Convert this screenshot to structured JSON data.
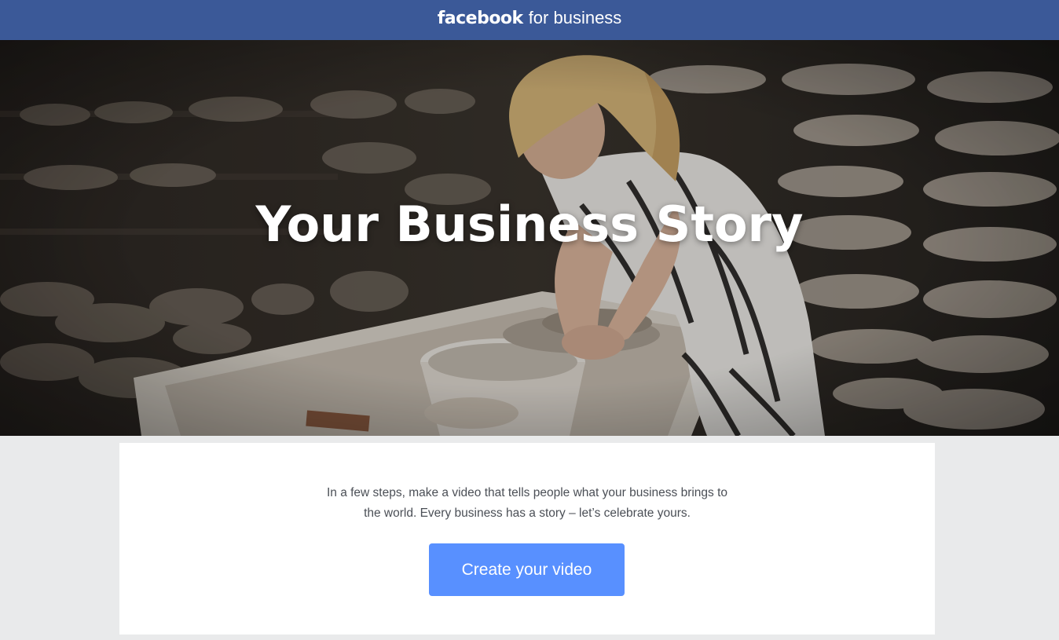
{
  "header": {
    "logo_text": "facebook",
    "logo_suffix": "for business",
    "background_color": "#3b5998"
  },
  "hero": {
    "title": "Your Business Story",
    "image_description_icon": "pottery-workshop-image"
  },
  "intro": {
    "line1": "In a few steps, make a video that tells people what your business brings to",
    "line2": "the world. Every business has a story – let’s celebrate yours."
  },
  "cta": {
    "label": "Create your video",
    "color": "#5890ff"
  }
}
